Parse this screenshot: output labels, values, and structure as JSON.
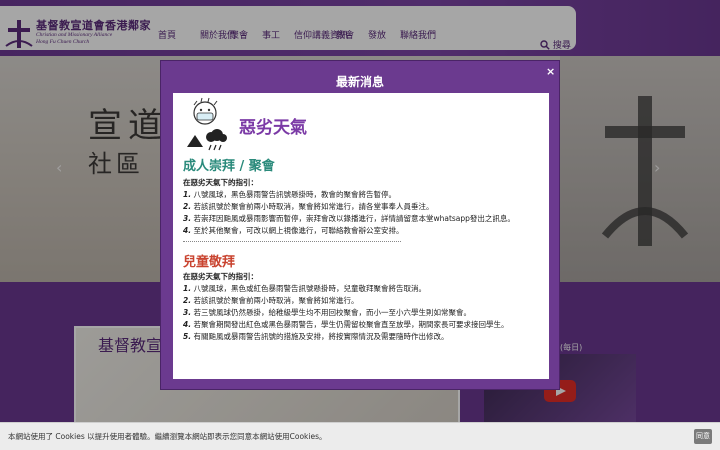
{
  "header": {
    "logo": {
      "cn": "基督教宣道會香港鄰家",
      "en_line1": "Christian and Missionary Alliance",
      "en_line2": "Hong Fu Chuen Church"
    },
    "nav": [
      "首頁",
      "關於我們",
      "聚會",
      "事工",
      "信仰講義資訊",
      "教會",
      "發放",
      "聯絡我們"
    ],
    "search_label": "搜尋"
  },
  "banner": {
    "line1": "宣道",
    "line2": "社區"
  },
  "lower": {
    "image_title": "基督教宣",
    "side_label": "(每日)"
  },
  "modal": {
    "title": "最新消息",
    "close_label": "×",
    "warning_title": "惡劣天氣",
    "adult": {
      "title": "成人崇拜 / 聚會",
      "subhead": "在惡劣天氣下的指引：",
      "items": [
        {
          "num": "1.",
          "text": "八號風球，黑色暴雨警告訊號懸掛時，教會的聚會將告暫停。"
        },
        {
          "num": "2.",
          "text": "若該訊號於聚會前兩小時取消，聚會將如常進行，請各堂事奉人員垂注。"
        },
        {
          "num": "3.",
          "text": "若崇拜因颱風或暴雨影響而暫停，崇拜會改以錄播進行，詳情請留意本堂whatsapp發出之訊息。"
        },
        {
          "num": "4.",
          "text": "至於其他聚會，可改以網上視像進行，可聯絡教會辦公室安排。"
        }
      ]
    },
    "children": {
      "title": "兒童敬拜",
      "subhead": "在惡劣天氣下的指引：",
      "items": [
        {
          "num": "1.",
          "text": "八號風球，黑色或紅色暴雨警告訊號懸掛時，兒童敬拜聚會將告取消。"
        },
        {
          "num": "2.",
          "text": "若該訊號於聚會前兩小時取消，聚會將如常進行。"
        },
        {
          "num": "3.",
          "text": "若三號風球仍然懸掛，給稚級學生均不用回校聚會，而小一至小六學生則如常聚會。"
        },
        {
          "num": "4.",
          "text": "若聚會期間發出紅色或黑色暴雨警告，學生仍需留校聚會直至放學，期間家長可要求接回學生。"
        },
        {
          "num": "5.",
          "text": "有關颱風或暴雨警告訊號的措施及安排，將按實際情況及需要隨時作出修改。"
        }
      ]
    }
  },
  "cookie": {
    "text": "本網站使用了 Cookies 以提升使用者體驗。繼續瀏覽本網站即表示您同意本網站使用Cookies。",
    "button_label": "同意"
  },
  "colors": {
    "brand_purple": "#6b3a8f",
    "teal_heading": "#2a8a7b",
    "red_heading": "#c9432f",
    "warning_purple": "#7b3aa6"
  }
}
